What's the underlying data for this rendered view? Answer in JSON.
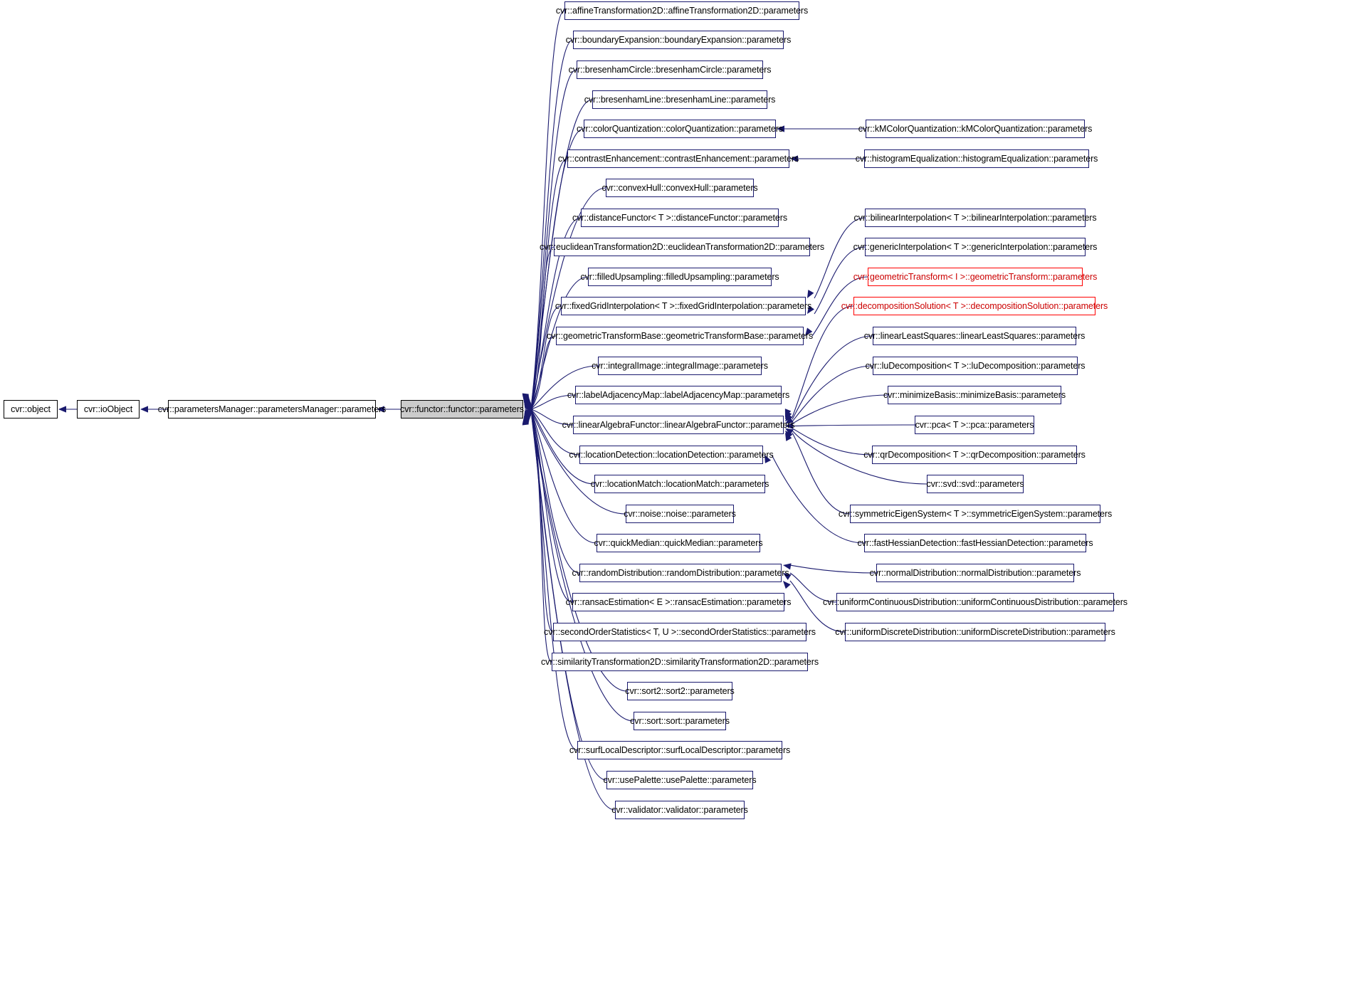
{
  "diagram": {
    "type": "doxygen-inheritance-graph",
    "title": "cvr::functor::functor::parameters inheritance diagram",
    "colors": {
      "edge": "#1a1a6e",
      "node_border": "#1a1a6e",
      "node_fill": "#ffffff",
      "root_fill": "#cccccc",
      "highlight_border": "#ff0000",
      "highlight_text": "#cc0000",
      "background": "#ffffff"
    },
    "ancestors": [
      {
        "id": "object",
        "label": "cvr::object"
      },
      {
        "id": "ioObject",
        "label": "cvr::ioObject"
      },
      {
        "id": "paramsManager",
        "label": "cvr::parametersManager::parametersManager::parameters"
      }
    ],
    "root": {
      "id": "root",
      "label": "cvr::functor::functor::parameters"
    },
    "derived": [
      {
        "id": "affineTransformation2D",
        "label": "cvr::affineTransformation2D::affineTransformation2D::parameters"
      },
      {
        "id": "boundaryExpansion",
        "label": "cvr::boundaryExpansion::boundaryExpansion::parameters"
      },
      {
        "id": "bresenhamCircle",
        "label": "cvr::bresenhamCircle::bresenhamCircle::parameters"
      },
      {
        "id": "bresenhamLine",
        "label": "cvr::bresenhamLine::bresenhamLine::parameters"
      },
      {
        "id": "colorQuantization",
        "label": "cvr::colorQuantization::colorQuantization::parameters"
      },
      {
        "id": "contrastEnhancement",
        "label": "cvr::contrastEnhancement::contrastEnhancement::parameters"
      },
      {
        "id": "convexHull",
        "label": "cvr::convexHull::convexHull::parameters"
      },
      {
        "id": "distanceFunctor",
        "label": "cvr::distanceFunctor< T >::distanceFunctor::parameters"
      },
      {
        "id": "euclideanTransformation2D",
        "label": "cvr::euclideanTransformation2D::euclideanTransformation2D::parameters"
      },
      {
        "id": "filledUpsampling",
        "label": "cvr::filledUpsampling::filledUpsampling::parameters"
      },
      {
        "id": "fixedGridInterpolation",
        "label": "cvr::fixedGridInterpolation< T >::fixedGridInterpolation::parameters"
      },
      {
        "id": "geometricTransformBase",
        "label": "cvr::geometricTransformBase::geometricTransformBase::parameters"
      },
      {
        "id": "integralImage",
        "label": "cvr::integralImage::integralImage::parameters"
      },
      {
        "id": "labelAdjacencyMap",
        "label": "cvr::labelAdjacencyMap::labelAdjacencyMap::parameters"
      },
      {
        "id": "linearAlgebraFunctor",
        "label": "cvr::linearAlgebraFunctor::linearAlgebraFunctor::parameters"
      },
      {
        "id": "locationDetection",
        "label": "cvr::locationDetection::locationDetection::parameters"
      },
      {
        "id": "locationMatch",
        "label": "cvr::locationMatch::locationMatch::parameters"
      },
      {
        "id": "noise",
        "label": "cvr::noise::noise::parameters"
      },
      {
        "id": "quickMedian",
        "label": "cvr::quickMedian::quickMedian::parameters"
      },
      {
        "id": "randomDistribution",
        "label": "cvr::randomDistribution::randomDistribution::parameters"
      },
      {
        "id": "ransacEstimation",
        "label": "cvr::ransacEstimation< E >::ransacEstimation::parameters"
      },
      {
        "id": "secondOrderStatistics",
        "label": "cvr::secondOrderStatistics< T, U >::secondOrderStatistics::parameters"
      },
      {
        "id": "similarityTransformation2D",
        "label": "cvr::similarityTransformation2D::similarityTransformation2D::parameters"
      },
      {
        "id": "sort2",
        "label": "cvr::sort2::sort2::parameters"
      },
      {
        "id": "sort",
        "label": "cvr::sort::sort::parameters"
      },
      {
        "id": "surfLocalDescriptor",
        "label": "cvr::surfLocalDescriptor::surfLocalDescriptor::parameters"
      },
      {
        "id": "usePalette",
        "label": "cvr::usePalette::usePalette::parameters"
      },
      {
        "id": "validator",
        "label": "cvr::validator::validator::parameters"
      }
    ],
    "leaves": [
      {
        "id": "kMColorQuantization",
        "label": "cvr::kMColorQuantization::kMColorQuantization::parameters",
        "highlight": false
      },
      {
        "id": "histogramEqualization",
        "label": "cvr::histogramEqualization::histogramEqualization::parameters",
        "highlight": false
      },
      {
        "id": "bilinearInterpolation",
        "label": "cvr::bilinearInterpolation< T >::bilinearInterpolation::parameters",
        "highlight": false
      },
      {
        "id": "genericInterpolation",
        "label": "cvr::genericInterpolation< T >::genericInterpolation::parameters",
        "highlight": false
      },
      {
        "id": "geometricTransform",
        "label": "cvr::geometricTransform< I >::geometricTransform::parameters",
        "highlight": true
      },
      {
        "id": "decompositionSolution",
        "label": "cvr::decompositionSolution< T >::decompositionSolution::parameters",
        "highlight": true
      },
      {
        "id": "linearLeastSquares",
        "label": "cvr::linearLeastSquares::linearLeastSquares::parameters",
        "highlight": false
      },
      {
        "id": "luDecomposition",
        "label": "cvr::luDecomposition< T >::luDecomposition::parameters",
        "highlight": false
      },
      {
        "id": "minimizeBasis",
        "label": "cvr::minimizeBasis::minimizeBasis::parameters",
        "highlight": false
      },
      {
        "id": "pca",
        "label": "cvr::pca< T >::pca::parameters",
        "highlight": false
      },
      {
        "id": "qrDecomposition",
        "label": "cvr::qrDecomposition< T >::qrDecomposition::parameters",
        "highlight": false
      },
      {
        "id": "svd",
        "label": "cvr::svd::svd::parameters",
        "highlight": false
      },
      {
        "id": "symmetricEigenSystem",
        "label": "cvr::symmetricEigenSystem< T >::symmetricEigenSystem::parameters",
        "highlight": false
      },
      {
        "id": "fastHessianDetection",
        "label": "cvr::fastHessianDetection::fastHessianDetection::parameters",
        "highlight": false
      },
      {
        "id": "normalDistribution",
        "label": "cvr::normalDistribution::normalDistribution::parameters",
        "highlight": false
      },
      {
        "id": "uniformContinuousDistribution",
        "label": "cvr::uniformContinuousDistribution::uniformContinuousDistribution::parameters",
        "highlight": false
      },
      {
        "id": "uniformDiscreteDistribution",
        "label": "cvr::uniformDiscreteDistribution::uniformDiscreteDistribution::parameters",
        "highlight": false
      }
    ]
  }
}
